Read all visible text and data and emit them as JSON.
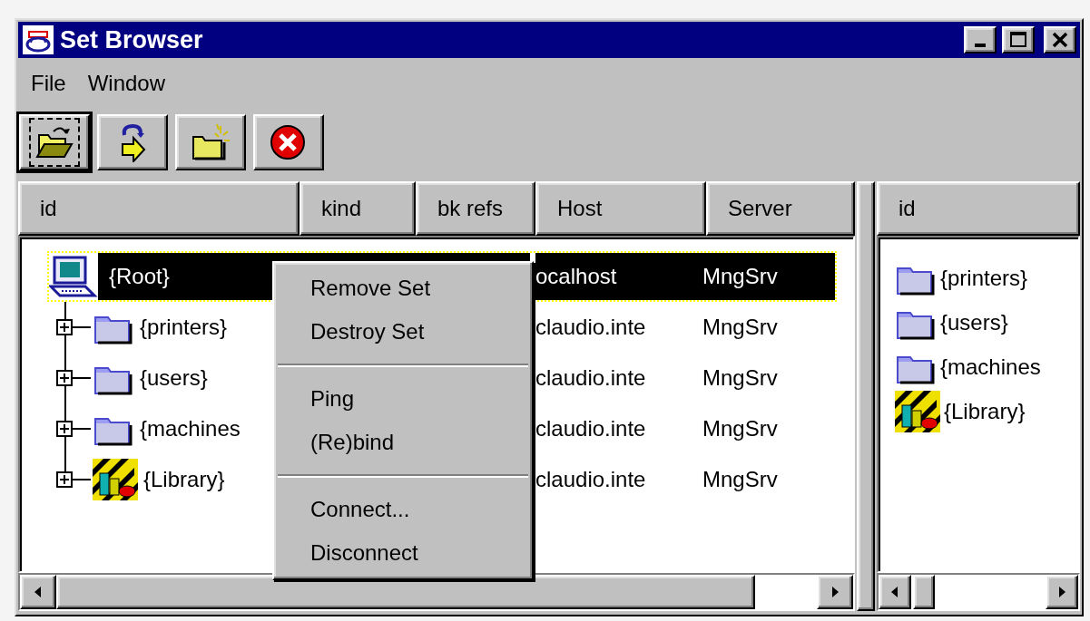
{
  "window": {
    "title": "Set Browser"
  },
  "menu": [
    {
      "label": "File"
    },
    {
      "label": "Window"
    }
  ],
  "toolbar": [
    {
      "kind": "open",
      "focused": true
    },
    {
      "kind": "rebind",
      "focused": false
    },
    {
      "kind": "new",
      "focused": false
    },
    {
      "kind": "delete",
      "focused": false
    }
  ],
  "left_table": {
    "columns": [
      "id",
      "kind",
      "bk refs",
      "Host",
      "Server"
    ],
    "tree": {
      "id": "{Root}",
      "kind": "computer",
      "selected": true,
      "host": "ocalhost",
      "server": "MngSrv",
      "children": [
        {
          "id": "{printers}",
          "kind": "folder",
          "selected": false,
          "expanded": false,
          "host": "claudio.inte",
          "server": "MngSrv"
        },
        {
          "id": "{users}",
          "kind": "folder",
          "selected": false,
          "expanded": false,
          "host": "claudio.inte",
          "server": "MngSrv"
        },
        {
          "id": "{machines",
          "kind": "folder",
          "selected": false,
          "expanded": false,
          "host": "claudio.inte",
          "server": "MngSrv"
        },
        {
          "id": "{Library}",
          "kind": "library",
          "selected": false,
          "expanded": false,
          "host": "claudio.inte",
          "server": "MngSrv"
        }
      ]
    }
  },
  "right_table": {
    "columns": [
      "id"
    ],
    "items": [
      {
        "label": "{printers}",
        "kind": "folder"
      },
      {
        "label": "{users}",
        "kind": "folder"
      },
      {
        "label": "{machines",
        "kind": "folder"
      },
      {
        "label": "{Library}",
        "kind": "library"
      }
    ]
  },
  "context_menu": {
    "groups": [
      {
        "items": [
          {
            "label": "Remove Set"
          },
          {
            "label": "Destroy Set"
          }
        ]
      },
      {
        "items": [
          {
            "label": "Ping"
          },
          {
            "label": "(Re)bind"
          }
        ]
      },
      {
        "items": [
          {
            "label": "Connect..."
          },
          {
            "label": "Disconnect"
          }
        ]
      }
    ]
  }
}
